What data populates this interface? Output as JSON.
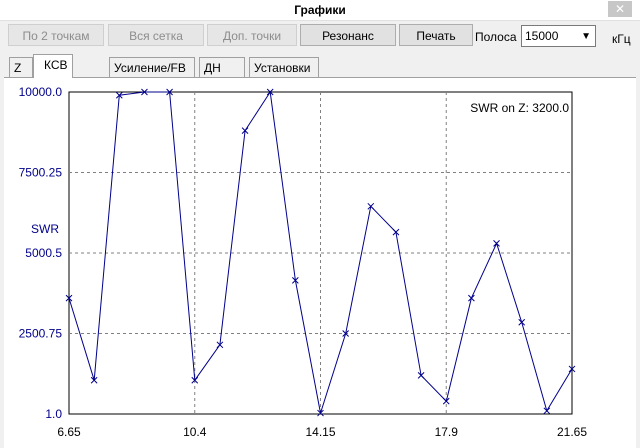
{
  "window": {
    "title": "Графики",
    "close_icon": "close-icon"
  },
  "toolbar": {
    "btn_two_points": "По 2 точкам",
    "btn_all_grid": "Вся сетка",
    "btn_extra_points": "Доп. точки",
    "btn_resonance": "Резонанс",
    "btn_print": "Печать",
    "band_label": "Полоса",
    "band_value": "15000",
    "unit_label": "кГц"
  },
  "tabs": [
    "Z",
    "КСВ",
    "Усиление/FB",
    "ДН",
    "Установки"
  ],
  "active_tab": "КСВ",
  "chart_data": {
    "type": "line",
    "ylabel": "SWR",
    "annotation": "SWR on Z: 3200.0",
    "x_ticks": [
      "6.65",
      "10.4",
      "14.15",
      "17.9",
      "21.65"
    ],
    "y_ticks": [
      "1.0",
      "2500.75",
      "5000.5",
      "7500.25",
      "10000.0"
    ],
    "xlim": [
      6.65,
      21.65
    ],
    "ylim": [
      1.0,
      10000.0
    ],
    "grid": true,
    "color": "#00008b",
    "x": [
      6.65,
      7.4,
      8.15,
      8.9,
      9.65,
      10.4,
      11.15,
      11.9,
      12.65,
      13.4,
      14.15,
      14.9,
      15.65,
      16.4,
      17.15,
      17.9,
      18.65,
      19.4,
      20.15,
      20.9,
      21.65
    ],
    "y": [
      3600,
      1050,
      9900,
      10000,
      10000,
      1050,
      2150,
      8800,
      10000,
      4150,
      30,
      2500,
      6450,
      5650,
      1200,
      400,
      3600,
      5300,
      2850,
      100,
      1400
    ]
  }
}
